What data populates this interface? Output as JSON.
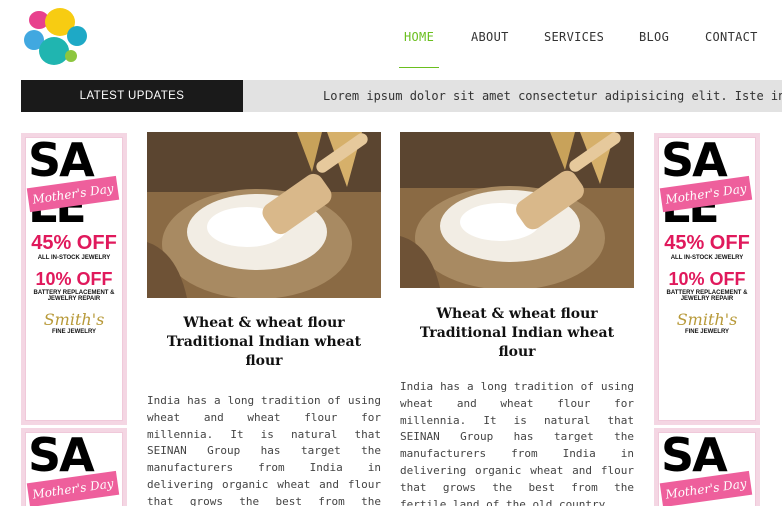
{
  "header": {
    "logo_icon": "colorful-pebbles-logo",
    "nav": [
      {
        "label": "HOME",
        "active": true
      },
      {
        "label": "ABOUT",
        "active": false
      },
      {
        "label": "SERVICES",
        "active": false
      },
      {
        "label": "BLOG",
        "active": false
      },
      {
        "label": "CONTACT",
        "active": false
      }
    ],
    "accent_color": "#6abf1e"
  },
  "ticker": {
    "label": "LATEST UPDATES",
    "text": "Lorem ipsum dolor sit amet consectetur adipisicing elit. Iste invento"
  },
  "ad": {
    "sale_line1": "SA",
    "sale_line2": "LE",
    "banner": "Mother's Day",
    "offer1": "45% OFF",
    "offer1_sub": "ALL IN-STOCK JEWELRY",
    "offer2": "10% OFF",
    "offer2_sub": "BATTERY REPLACEMENT & JEWELRY REPAIR",
    "brand": "Smith's",
    "brand_sub": "FINE JEWELRY"
  },
  "articles": [
    {
      "title": "Wheat & wheat flour Traditional Indian wheat flour",
      "body": "India has a long tradition of using wheat and wheat flour for millennia. It is natural that SEINAN Group has target the manufacturers from India in delivering organic wheat and flour that grows the best from the fertile land of the old country."
    },
    {
      "title": "Wheat & wheat flour Traditional Indian wheat flour",
      "body": "India has a long tradition of using wheat and wheat flour for millennia. It is natural that SEINAN Group has target the manufacturers from India in delivering organic wheat and flour that grows the best from the fertile land of the old country."
    }
  ]
}
